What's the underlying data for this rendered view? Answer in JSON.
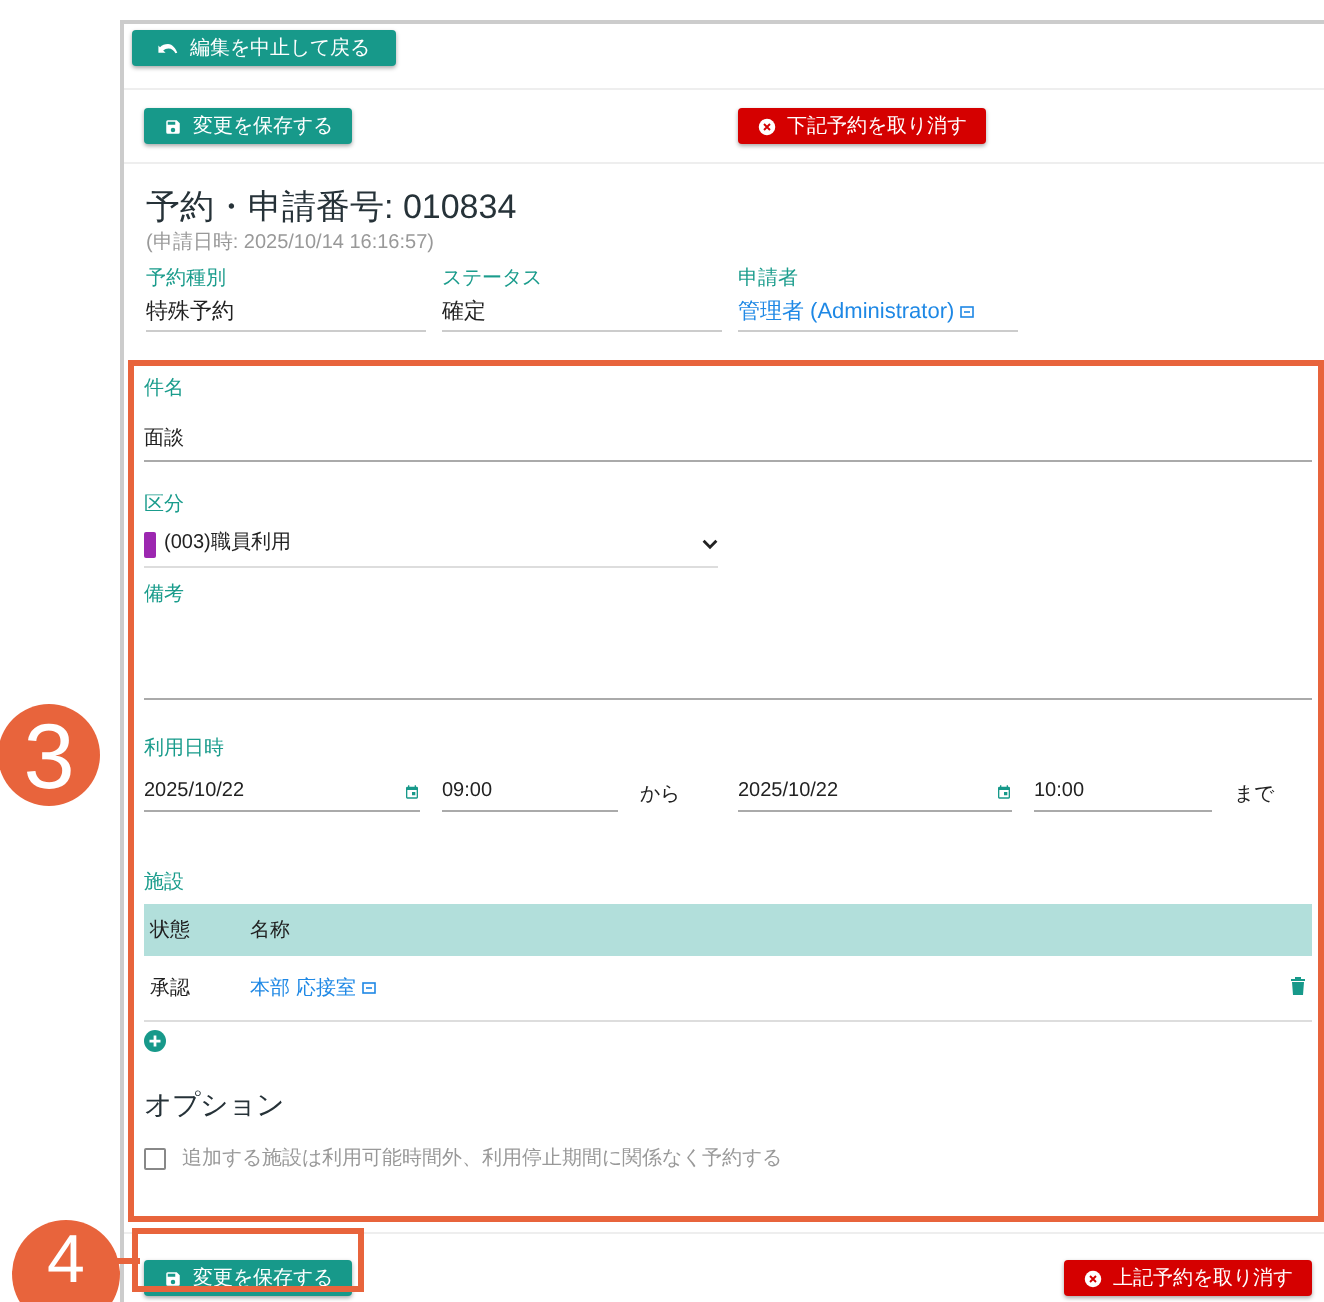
{
  "top_bar": {
    "back_button": "編集を中止して戻る"
  },
  "top_actions": {
    "save_button": "変更を保存する",
    "cancel_button": "下記予約を取り消す"
  },
  "header": {
    "title": "予約・申請番号: 010834",
    "submitted": "(申請日時: 2025/10/14 16:16:57)"
  },
  "summary_fields": [
    {
      "label": "予約種別",
      "value": "特殊予約",
      "kind": "text"
    },
    {
      "label": "ステータス",
      "value": "確定",
      "kind": "text"
    },
    {
      "label": "申請者",
      "value": "管理者 (Administrator)",
      "kind": "link"
    }
  ],
  "form": {
    "subject": {
      "label": "件名",
      "value": "面談"
    },
    "category": {
      "label": "区分",
      "value": "(003)職員利用",
      "color": "#9c27b0"
    },
    "remarks": {
      "label": "備考"
    },
    "schedule": {
      "label": "利用日時",
      "start_date": "2025/10/22",
      "start_time": "09:00",
      "from": "から",
      "end_date": "2025/10/22",
      "end_time": "10:00",
      "until": "まで"
    },
    "facilities": {
      "label": "施設",
      "columns": [
        "状態",
        "名称"
      ],
      "rows": [
        {
          "status": "承認",
          "name": "本部 応接室"
        }
      ]
    },
    "options": {
      "heading": "オプション",
      "items": [
        {
          "label": "追加する施設は利用可能時間外、利用停止期間に関係なく予約する",
          "checked": false
        }
      ]
    }
  },
  "bottom_actions": {
    "save_button": "変更を保存する",
    "cancel_button": "上記予約を取り消す"
  },
  "annotations": [
    {
      "label": "3"
    },
    {
      "label": "4"
    }
  ]
}
